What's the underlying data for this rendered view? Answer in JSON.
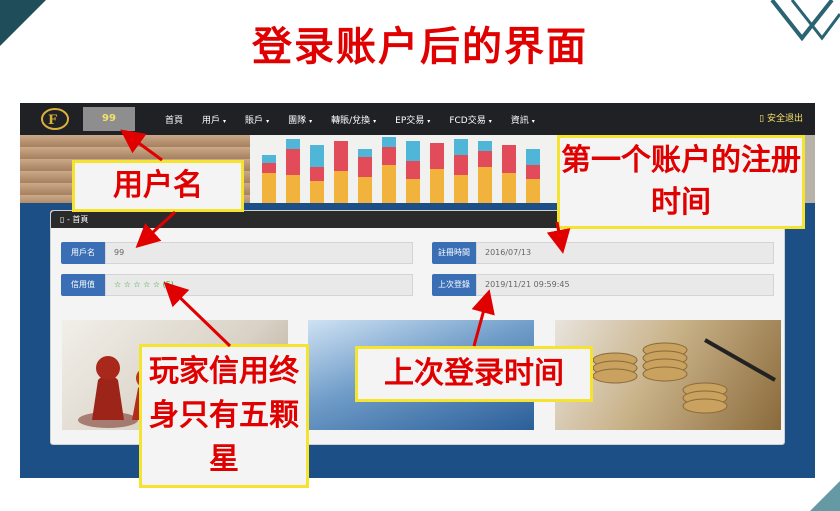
{
  "slide": {
    "title": "登录账户后的界面"
  },
  "nav": {
    "user_chip": "99",
    "items": [
      {
        "label": "首頁",
        "has_caret": false
      },
      {
        "label": "用戶",
        "has_caret": true
      },
      {
        "label": "賬戶",
        "has_caret": true
      },
      {
        "label": "團隊",
        "has_caret": true
      },
      {
        "label": "轉賬/兌換",
        "has_caret": true
      },
      {
        "label": "EP交易",
        "has_caret": true
      },
      {
        "label": "FCD交易",
        "has_caret": true
      },
      {
        "label": "資訊",
        "has_caret": true
      }
    ],
    "caret_glyph": "▾",
    "logout": "安全退出",
    "logo_text": "F"
  },
  "panel": {
    "breadcrumb": "▯ - 首頁",
    "fields": {
      "username_label": "用戶名",
      "username_value": "99",
      "register_label": "註冊時間",
      "register_value": "2016/07/13",
      "credit_label": "信用值",
      "credit_stars": "☆ ☆ ☆ ☆ ☆",
      "credit_count": "(5)",
      "lastlogin_label": "上次登錄",
      "lastlogin_value": "2019/11/21 09:59:45"
    }
  },
  "callouts": {
    "username": "用户名",
    "register": "第一个账户的注册时间",
    "credit": "玩家信用终身只有五颗星",
    "lastlogin": "上次登录时间"
  },
  "colors": {
    "title_red": "#e00000",
    "callout_border": "#f4e430",
    "nav_bg": "#202124",
    "label_blue": "#3a6fb5",
    "arrow_red": "#e00000"
  }
}
